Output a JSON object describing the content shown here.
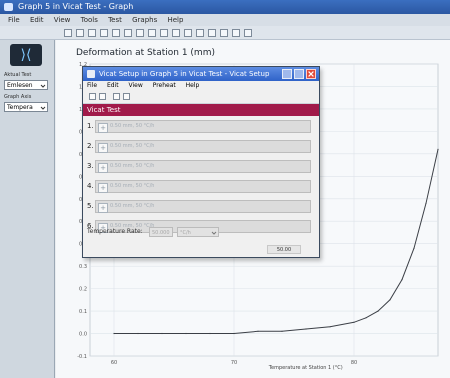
{
  "window": {
    "title": "Graph 5 in Vicat Test - Graph"
  },
  "menubar": {
    "items": [
      "File",
      "Edit",
      "View",
      "Tools",
      "Test",
      "Graphs",
      "Help"
    ]
  },
  "left_panel": {
    "logo_symbol": "⟩⟨",
    "load_label": "Aktual Test",
    "load_value": "Emlesen",
    "graph_axis_label": "Graph Axis",
    "graph_axis_value": "Tempera"
  },
  "graph": {
    "title": "Deformation at Station 1 (mm)",
    "y_ticks": [
      "1.2",
      "1.1",
      "1.0",
      "0.9",
      "0.8",
      "0.7",
      "0.6",
      "0.5",
      "0.4",
      "0.3",
      "0.2",
      "0.1",
      "0.0",
      "-0.1"
    ],
    "x_ticks": [
      "60",
      "70",
      "80"
    ],
    "x_label": "Temperature at Station 1 (°C)"
  },
  "chart_data": {
    "type": "line",
    "title": "Deformation at Station 1 (mm)",
    "xlabel": "Temperature at Station 1 (°C)",
    "ylabel": "",
    "xlim": [
      58,
      87
    ],
    "ylim": [
      -0.1,
      1.2
    ],
    "series": [
      {
        "name": "",
        "x": [
          60,
          62,
          64,
          66,
          68,
          70,
          72,
          74,
          76,
          78,
          80,
          81,
          82,
          83,
          84,
          85,
          86,
          87
        ],
        "y": [
          0.0,
          0.0,
          0.0,
          0.0,
          0.0,
          0.0,
          0.01,
          0.01,
          0.02,
          0.03,
          0.05,
          0.07,
          0.1,
          0.15,
          0.24,
          0.38,
          0.58,
          0.82
        ]
      }
    ]
  },
  "dialog": {
    "title": "Vicat Setup in Graph 5 in Vicat Test - Vicat Setup",
    "menu": [
      "File",
      "Edit",
      "View",
      "Preheat",
      "Help"
    ],
    "section_title": "Vicat Test",
    "stations": [
      {
        "num": "1.",
        "value": "0.50 mm, 50 °C/h"
      },
      {
        "num": "2.",
        "value": "0.50 mm, 50 °C/h"
      },
      {
        "num": "3.",
        "value": "0.50 mm, 50 °C/h"
      },
      {
        "num": "4.",
        "value": "0.50 mm, 50 °C/h"
      },
      {
        "num": "5.",
        "value": "0.50 mm, 50 °C/h"
      },
      {
        "num": "6.",
        "value": "0.50 mm, 50 °C/h"
      }
    ],
    "temperature_rate_label": "Temperature Rate:",
    "temperature_rate_value": "50.000",
    "temperature_rate_unit": "°C/h",
    "status_value": "50.00"
  }
}
